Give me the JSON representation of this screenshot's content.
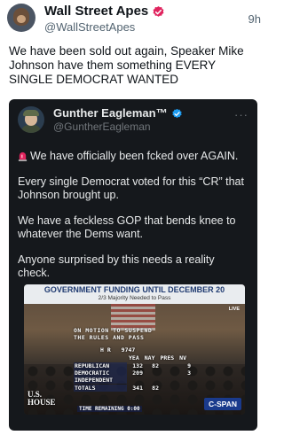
{
  "tweet": {
    "display_name": "Wall Street Apes",
    "handle": "@WallStreetApes",
    "time": "9h",
    "text": "We have been sold out again, Speaker Mike Johnson have them something EVERY SINGLE DEMOCRAT WANTED"
  },
  "quote": {
    "display_name": "Gunther Eagleman™",
    "handle": "@GuntherEagleman",
    "more": "···",
    "paragraphs": [
      "We have officially been fcked over AGAIN.",
      "Every single Democrat voted for this “CR” that Johnson brought up.",
      "We have a feckless GOP that bends knee to whatever the Dems want.",
      "Anyone surprised by this needs a reality check."
    ],
    "video": {
      "banner_title": "GOVERNMENT FUNDING UNTIL DECEMBER 20",
      "banner_sub": "2/3 Majority Needed to Pass",
      "live": "LIVE",
      "motion": "ON MOTION TO SUSPEND THE RULES AND PASS",
      "bill_prefix": "H R",
      "bill_number": "9747",
      "headers": [
        "YEA",
        "NAY",
        "PRES",
        "NV"
      ],
      "rows": [
        {
          "label": "REPUBLICAN",
          "yea": "132",
          "nay": "82",
          "pres": "",
          "nv": "9"
        },
        {
          "label": "DEMOCRATIC",
          "yea": "209",
          "nay": "",
          "pres": "",
          "nv": "3"
        },
        {
          "label": "INDEPENDENT",
          "yea": "",
          "nay": "",
          "pres": "",
          "nv": ""
        },
        {
          "label": "TOTALS",
          "yea": "341",
          "nay": "82",
          "pres": "",
          "nv": ""
        }
      ],
      "time_remaining_label": "TIME REMAINING",
      "time_remaining": "0:00",
      "network": "C-SPAN",
      "house_logo_line1": "U.S.",
      "house_logo_line2": "HOUSE"
    }
  },
  "colors": {
    "verified": "#1d9bf0",
    "quote_bg": "#15181c",
    "siren": "#e0245e"
  }
}
